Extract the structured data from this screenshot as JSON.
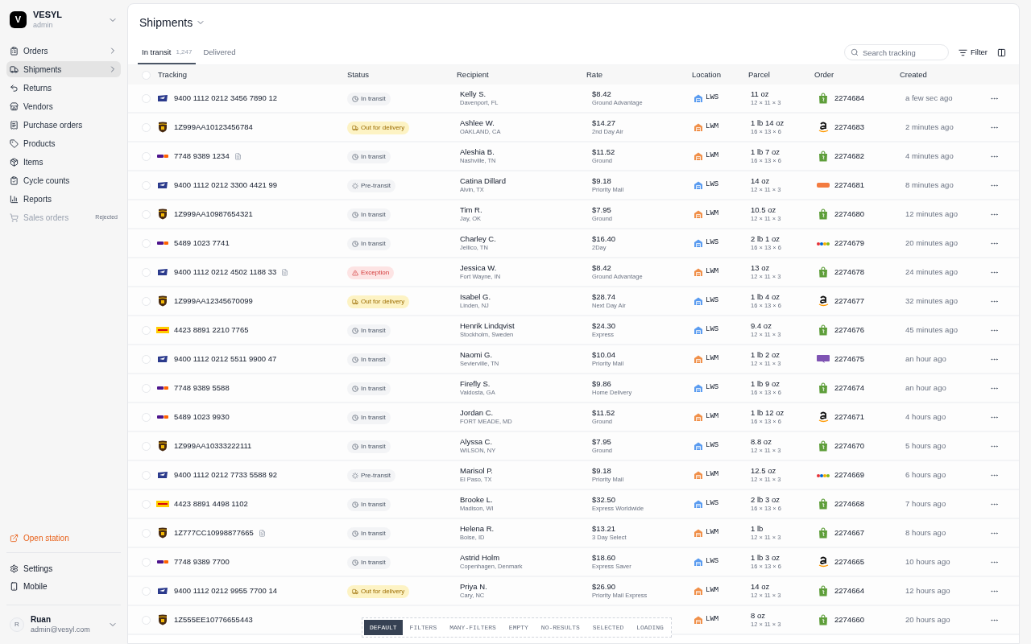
{
  "workspace": {
    "initial": "V",
    "name": "VESYL",
    "role": "admin"
  },
  "nav": [
    {
      "label": "Orders",
      "selected": false,
      "has_submenu": true,
      "disabled": false
    },
    {
      "label": "Shipments",
      "selected": true,
      "has_submenu": true,
      "disabled": false
    },
    {
      "label": "Returns",
      "selected": false,
      "has_submenu": false,
      "disabled": false
    },
    {
      "label": "Vendors",
      "selected": false,
      "has_submenu": false,
      "disabled": false
    },
    {
      "label": "Purchase orders",
      "selected": false,
      "has_submenu": false,
      "disabled": false
    },
    {
      "label": "Products",
      "selected": false,
      "has_submenu": false,
      "disabled": false
    },
    {
      "label": "Items",
      "selected": false,
      "has_submenu": false,
      "disabled": false
    },
    {
      "label": "Cycle counts",
      "selected": false,
      "has_submenu": false,
      "disabled": false
    },
    {
      "label": "Reports",
      "selected": false,
      "has_submenu": false,
      "disabled": false
    },
    {
      "label": "Sales orders",
      "selected": false,
      "has_submenu": false,
      "disabled": true,
      "badge": "Rejected"
    }
  ],
  "open_station": "Open station",
  "footer_nav": [
    {
      "label": "Settings"
    },
    {
      "label": "Mobile"
    }
  ],
  "user": {
    "initial": "R",
    "name": "Ruan",
    "email": "admin@vesyl.com"
  },
  "page_title": "Shipments",
  "tabs": [
    {
      "label": "In transit",
      "count": "1,247",
      "selected": true
    },
    {
      "label": "Delivered",
      "selected": false
    }
  ],
  "search": {
    "placeholder": "Search tracking"
  },
  "filter_button": "Filter",
  "all_selected": false,
  "columns": [
    "Tracking",
    "Status",
    "Recipient",
    "Rate",
    "Location",
    "Parcel",
    "Order",
    "Created"
  ],
  "rows": [
    {
      "selected": false,
      "tracking": {
        "kind": "usps",
        "number": "9400 1112 0212 3456 7890 12",
        "has_label": false
      },
      "status": {
        "kind": "transit",
        "label": "In transit"
      },
      "recipient": "Kelly S.",
      "place": "Davenport, FL",
      "rate": "$8.42",
      "service": "Ground Advantage",
      "location": {
        "code": "LWS",
        "color": "#5b9cf0"
      },
      "weight": "11 oz",
      "dims": "12 × 11 × 3",
      "order": {
        "kind": "shopify",
        "number": "2274684"
      },
      "created": "a few sec ago"
    },
    {
      "selected": false,
      "tracking": {
        "kind": "ups",
        "number": "1Z999AA10123456784",
        "has_label": false
      },
      "status": {
        "kind": "out",
        "label": "Out for delivery"
      },
      "recipient": "Ashlee W.",
      "place": "OAKLAND, CA",
      "rate": "$14.27",
      "service": "2nd Day Air",
      "location": {
        "code": "LWM",
        "color": "#f0904a"
      },
      "weight": "1 lb 14 oz",
      "dims": "16 × 13 × 6",
      "order": {
        "kind": "amazon",
        "number": "2274683"
      },
      "created": "2 minutes ago"
    },
    {
      "selected": false,
      "tracking": {
        "kind": "fedex",
        "number": "7748 9389 1234",
        "has_label": true
      },
      "status": {
        "kind": "transit",
        "label": "In transit"
      },
      "recipient": "Aleshia B.",
      "place": "Nashville, TN",
      "rate": "$11.52",
      "service": "Ground",
      "location": {
        "code": "LWM",
        "color": "#f0904a"
      },
      "weight": "1 lb 7 oz",
      "dims": "16 × 13 × 6",
      "order": {
        "kind": "shopify",
        "number": "2274682"
      },
      "created": "4 minutes ago"
    },
    {
      "selected": false,
      "tracking": {
        "kind": "usps",
        "number": "9400 1112 0212 3300 4421 99",
        "has_label": false
      },
      "status": {
        "kind": "pretransit",
        "label": "Pre-transit"
      },
      "recipient": "Catina Dillard",
      "place": "Alvin, TX",
      "rate": "$9.18",
      "service": "Priority Mail",
      "location": {
        "code": "LWS",
        "color": "#5b9cf0"
      },
      "weight": "14 oz",
      "dims": "12 × 11 × 3",
      "order": {
        "kind": "etsy",
        "number": "2274681"
      },
      "created": "8 minutes ago"
    },
    {
      "selected": false,
      "tracking": {
        "kind": "ups",
        "number": "1Z999AA10987654321",
        "has_label": false
      },
      "status": {
        "kind": "transit",
        "label": "In transit"
      },
      "recipient": "Tim R.",
      "place": "Jay, OK",
      "rate": "$7.95",
      "service": "Ground",
      "location": {
        "code": "LWM",
        "color": "#f0904a"
      },
      "weight": "10.5 oz",
      "dims": "12 × 11 × 3",
      "order": {
        "kind": "shopify",
        "number": "2274680"
      },
      "created": "12 minutes ago"
    },
    {
      "selected": false,
      "tracking": {
        "kind": "fedex",
        "number": "5489 1023 7741",
        "has_label": false
      },
      "status": {
        "kind": "transit",
        "label": "In transit"
      },
      "recipient": "Charley C.",
      "place": "Jellico, TN",
      "rate": "$16.40",
      "service": "2Day",
      "location": {
        "code": "LWS",
        "color": "#5b9cf0"
      },
      "weight": "2 lb 1 oz",
      "dims": "16 × 13 × 6",
      "order": {
        "kind": "ebay",
        "number": "2274679"
      },
      "created": "20 minutes ago"
    },
    {
      "selected": false,
      "tracking": {
        "kind": "usps",
        "number": "9400 1112 0212 4502 1188 33",
        "has_label": true
      },
      "status": {
        "kind": "exception",
        "label": "Exception"
      },
      "recipient": "Jessica W.",
      "place": "Fort Wayne, IN",
      "rate": "$8.42",
      "service": "Ground Advantage",
      "location": {
        "code": "LWM",
        "color": "#f0904a"
      },
      "weight": "13 oz",
      "dims": "12 × 11 × 3",
      "order": {
        "kind": "shopify",
        "number": "2274678"
      },
      "created": "24 minutes ago"
    },
    {
      "selected": false,
      "tracking": {
        "kind": "ups",
        "number": "1Z999AA12345670099",
        "has_label": false
      },
      "status": {
        "kind": "out",
        "label": "Out for delivery"
      },
      "recipient": "Isabel G.",
      "place": "Linden, NJ",
      "rate": "$28.74",
      "service": "Next Day Air",
      "location": {
        "code": "LWS",
        "color": "#5b9cf0"
      },
      "weight": "1 lb 4 oz",
      "dims": "16 × 13 × 6",
      "order": {
        "kind": "amazon",
        "number": "2274677"
      },
      "created": "32 minutes ago"
    },
    {
      "selected": false,
      "tracking": {
        "kind": "dhl",
        "number": "4423 8891 2210 7765",
        "has_label": false
      },
      "status": {
        "kind": "transit",
        "label": "In transit"
      },
      "recipient": "Henrik Lindqvist",
      "place": "Stockholm, Sweden",
      "rate": "$24.30",
      "service": "Express",
      "location": {
        "code": "LWS",
        "color": "#5b9cf0"
      },
      "weight": "9.4 oz",
      "dims": "12 × 11 × 3",
      "order": {
        "kind": "shopify",
        "number": "2274676"
      },
      "created": "45 minutes ago"
    },
    {
      "selected": false,
      "tracking": {
        "kind": "usps",
        "number": "9400 1112 0212 5511 9900 47",
        "has_label": false
      },
      "status": {
        "kind": "transit",
        "label": "In transit"
      },
      "recipient": "Naomi G.",
      "place": "Sevierville, TN",
      "rate": "$10.04",
      "service": "Priority Mail",
      "location": {
        "code": "LWM",
        "color": "#f0904a"
      },
      "weight": "1 lb 2 oz",
      "dims": "12 × 11 × 3",
      "order": {
        "kind": "woo",
        "number": "2274675"
      },
      "created": "an hour ago"
    },
    {
      "selected": false,
      "tracking": {
        "kind": "fedex",
        "number": "7748 9389 5588",
        "has_label": false
      },
      "status": {
        "kind": "transit",
        "label": "In transit"
      },
      "recipient": "Firefly S.",
      "place": "Valdosta, GA",
      "rate": "$9.86",
      "service": "Home Delivery",
      "location": {
        "code": "LWS",
        "color": "#5b9cf0"
      },
      "weight": "1 lb 9 oz",
      "dims": "16 × 13 × 6",
      "order": {
        "kind": "shopify",
        "number": "2274674"
      },
      "created": "an hour ago"
    },
    {
      "selected": false,
      "tracking": {
        "kind": "fedex",
        "number": "5489 1023 9930",
        "has_label": false
      },
      "status": {
        "kind": "transit",
        "label": "In transit"
      },
      "recipient": "Jordan C.",
      "place": "FORT MEADE, MD",
      "rate": "$11.52",
      "service": "Ground",
      "location": {
        "code": "LWM",
        "color": "#f0904a"
      },
      "weight": "1 lb 12 oz",
      "dims": "16 × 13 × 6",
      "order": {
        "kind": "amazon",
        "number": "2274671"
      },
      "created": "4 hours ago"
    },
    {
      "selected": false,
      "tracking": {
        "kind": "ups",
        "number": "1Z999AA10333222111",
        "has_label": false
      },
      "status": {
        "kind": "transit",
        "label": "In transit"
      },
      "recipient": "Alyssa C.",
      "place": "WILSON, NY",
      "rate": "$7.95",
      "service": "Ground",
      "location": {
        "code": "LWS",
        "color": "#5b9cf0"
      },
      "weight": "8.8 oz",
      "dims": "12 × 11 × 3",
      "order": {
        "kind": "shopify",
        "number": "2274670"
      },
      "created": "5 hours ago"
    },
    {
      "selected": false,
      "tracking": {
        "kind": "usps",
        "number": "9400 1112 0212 7733 5588 92",
        "has_label": false
      },
      "status": {
        "kind": "pretransit",
        "label": "Pre-transit"
      },
      "recipient": "Marisol P.",
      "place": "El Paso, TX",
      "rate": "$9.18",
      "service": "Priority Mail",
      "location": {
        "code": "LWM",
        "color": "#f0904a"
      },
      "weight": "12.5 oz",
      "dims": "12 × 11 × 3",
      "order": {
        "kind": "ebay",
        "number": "2274669"
      },
      "created": "6 hours ago"
    },
    {
      "selected": false,
      "tracking": {
        "kind": "dhl",
        "number": "4423 8891 4498 1102",
        "has_label": false
      },
      "status": {
        "kind": "transit",
        "label": "In transit"
      },
      "recipient": "Brooke L.",
      "place": "Madison, WI",
      "rate": "$32.50",
      "service": "Express Worldwide",
      "location": {
        "code": "LWS",
        "color": "#5b9cf0"
      },
      "weight": "2 lb 3 oz",
      "dims": "16 × 13 × 6",
      "order": {
        "kind": "shopify",
        "number": "2274668"
      },
      "created": "7 hours ago"
    },
    {
      "selected": false,
      "tracking": {
        "kind": "ups",
        "number": "1Z777CC10998877665",
        "has_label": true
      },
      "status": {
        "kind": "transit",
        "label": "In transit"
      },
      "recipient": "Helena R.",
      "place": "Boise, ID",
      "rate": "$13.21",
      "service": "3 Day Select",
      "location": {
        "code": "LWM",
        "color": "#f0904a"
      },
      "weight": "1 lb",
      "dims": "12 × 11 × 3",
      "order": {
        "kind": "shopify",
        "number": "2274667"
      },
      "created": "8 hours ago"
    },
    {
      "selected": false,
      "tracking": {
        "kind": "fedex",
        "number": "7748 9389 7700",
        "has_label": false
      },
      "status": {
        "kind": "transit",
        "label": "In transit"
      },
      "recipient": "Astrid Holm",
      "place": "Copenhagen, Denmark",
      "rate": "$18.60",
      "service": "Express Saver",
      "location": {
        "code": "LWS",
        "color": "#5b9cf0"
      },
      "weight": "1 lb 3 oz",
      "dims": "16 × 13 × 6",
      "order": {
        "kind": "amazon",
        "number": "2274665"
      },
      "created": "10 hours ago"
    },
    {
      "selected": false,
      "tracking": {
        "kind": "usps",
        "number": "9400 1112 0212 9955 7700 14",
        "has_label": false
      },
      "status": {
        "kind": "out",
        "label": "Out for delivery"
      },
      "recipient": "Priya N.",
      "place": "Cary, NC",
      "rate": "$26.90",
      "service": "Priority Mail Express",
      "location": {
        "code": "LWM",
        "color": "#f0904a"
      },
      "weight": "14 oz",
      "dims": "12 × 11 × 3",
      "order": {
        "kind": "shopify",
        "number": "2274664"
      },
      "created": "12 hours ago"
    },
    {
      "selected": false,
      "tracking": {
        "kind": "ups",
        "number": "1Z555EE10776655443",
        "has_label": false
      },
      "location": {
        "code": "LWM",
        "color": "#f0904a"
      },
      "weight": "8 oz",
      "dims": "12 × 11 × 3",
      "order": {
        "kind": "shopify",
        "number": "2274660"
      },
      "created": "20 hours ago"
    }
  ],
  "state_switcher": [
    {
      "label": "DEFAULT",
      "selected": true
    },
    {
      "label": "FILTERS",
      "selected": false
    },
    {
      "label": "MANY-FILTERS",
      "selected": false
    },
    {
      "label": "EMPTY",
      "selected": false
    },
    {
      "label": "NO-RESULTS",
      "selected": false
    },
    {
      "label": "SELECTED",
      "selected": false
    },
    {
      "label": "LOADING",
      "selected": false
    }
  ]
}
